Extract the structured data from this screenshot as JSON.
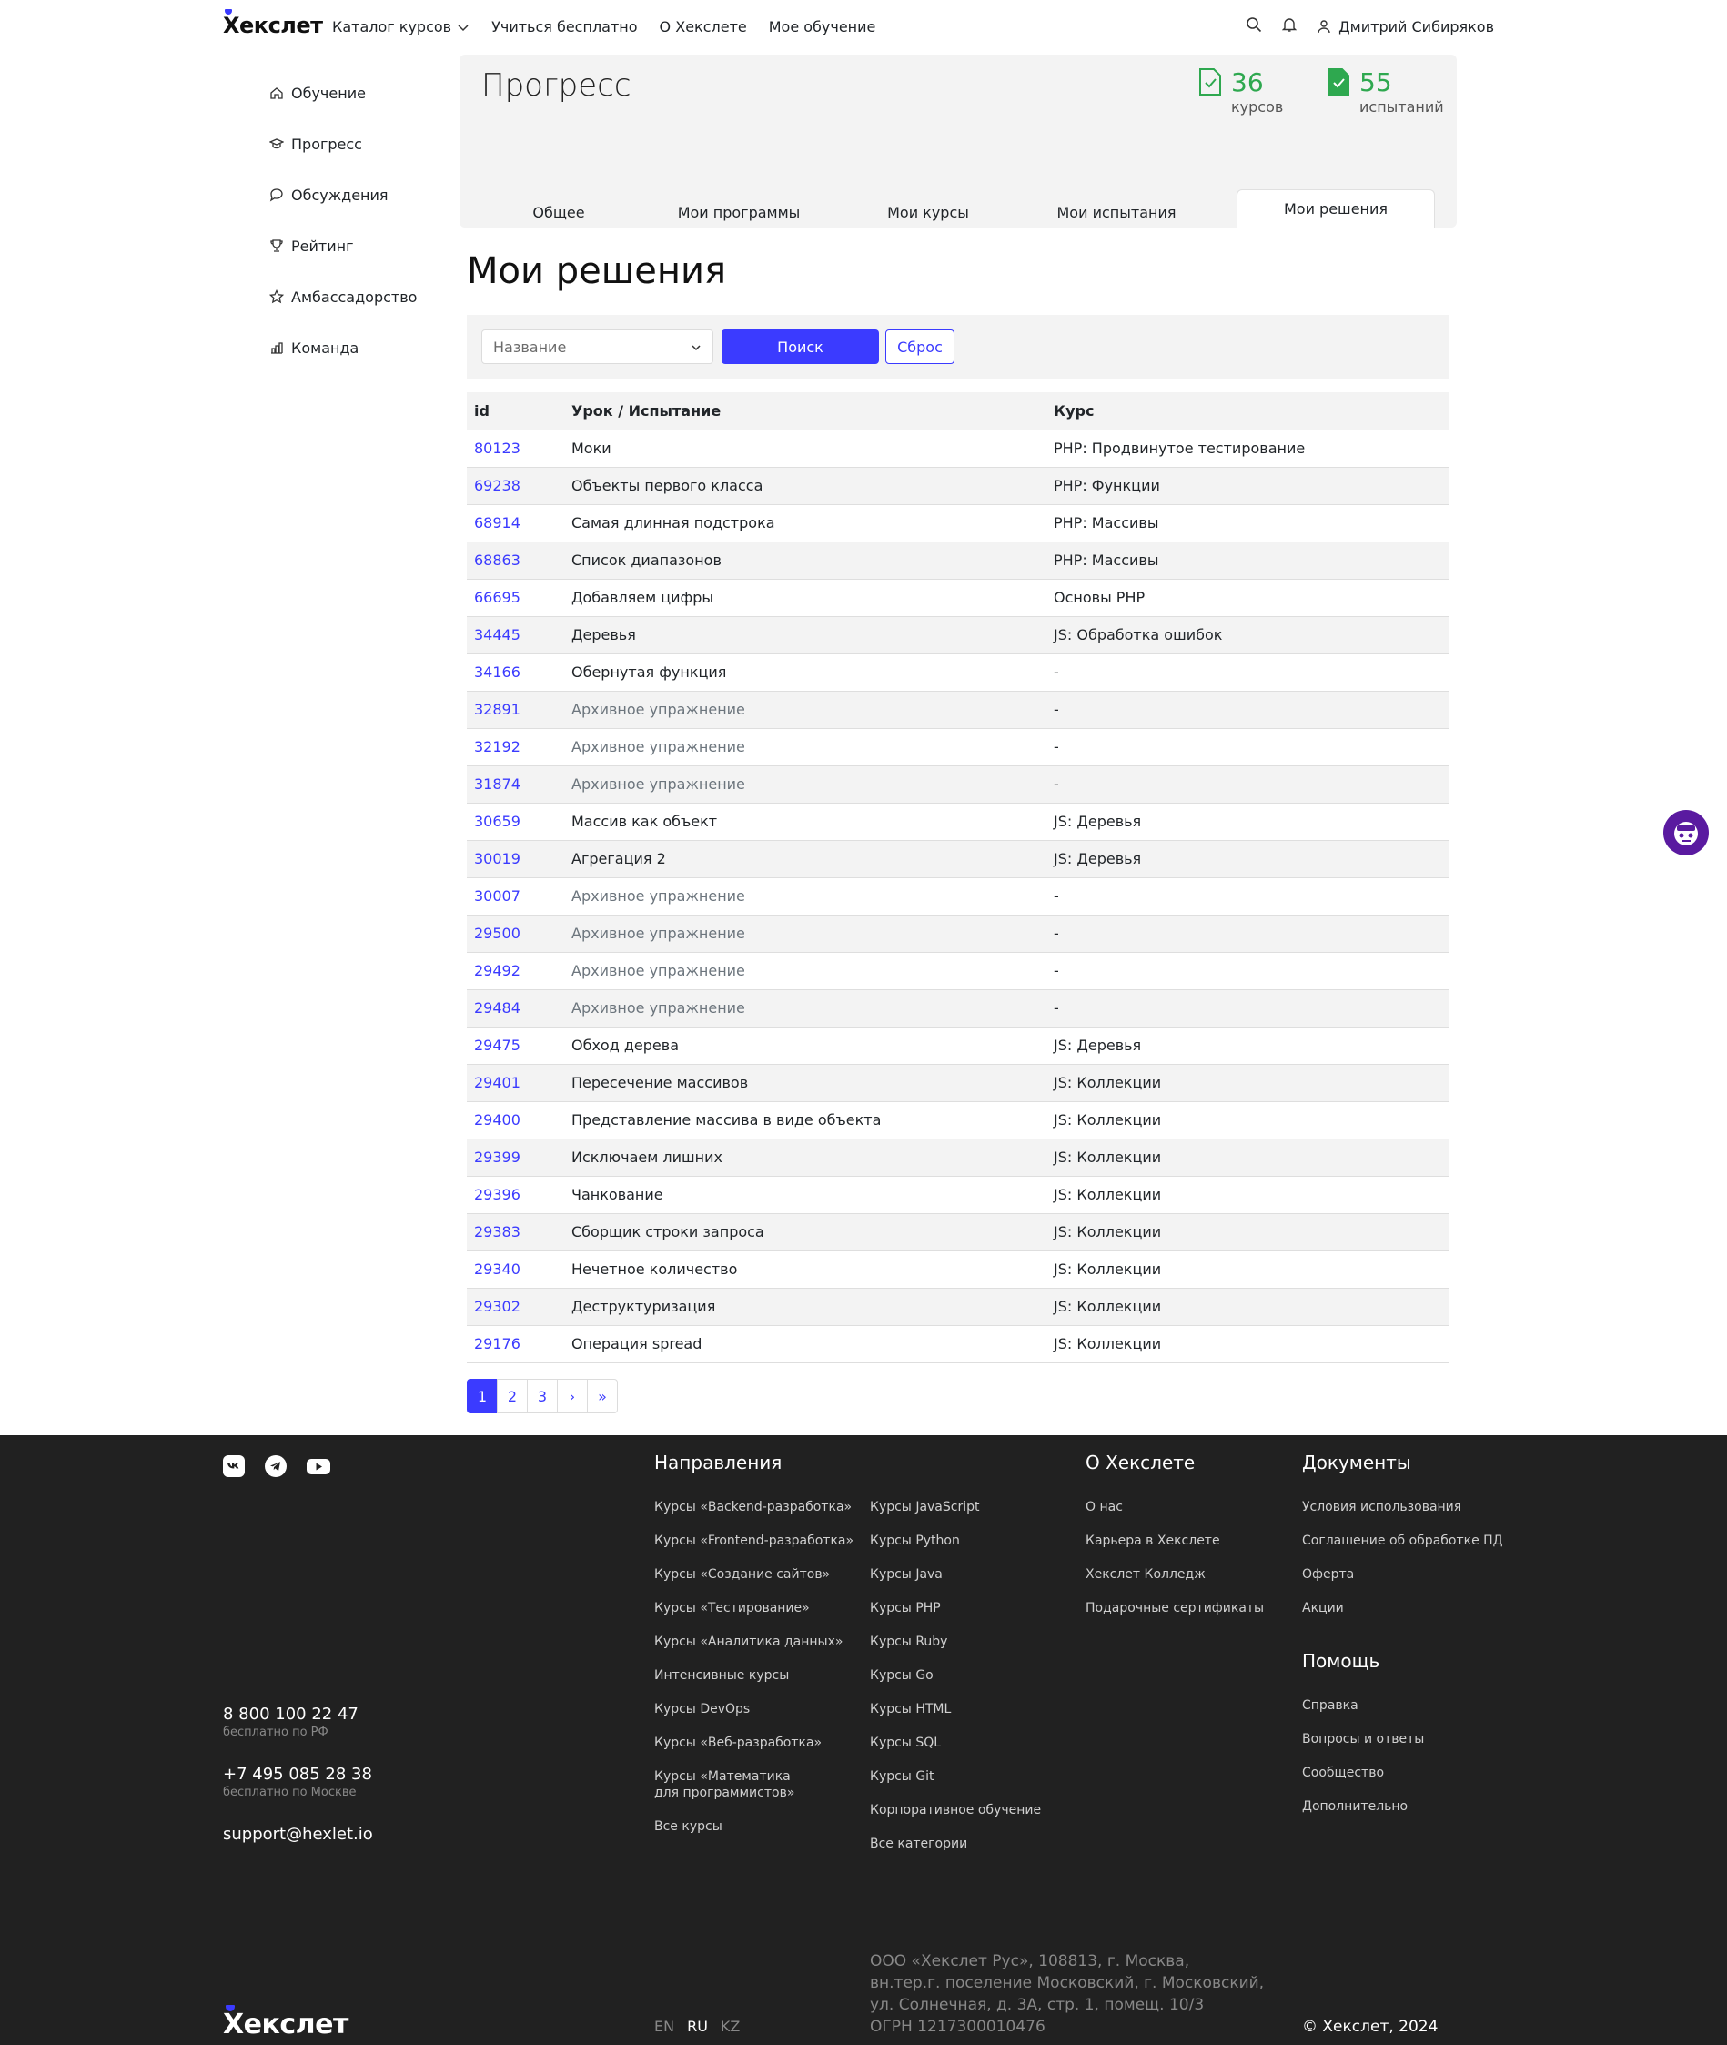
{
  "header": {
    "logo": "Хекслет",
    "nav": [
      "Каталог курсов",
      "Учиться бесплатно",
      "О Хекслете",
      "Мое обучение"
    ],
    "user_name": "Дмитрий Сибиряков"
  },
  "sidebar": {
    "items": [
      {
        "label": "Обучение",
        "icon": "home-icon"
      },
      {
        "label": "Прогресс",
        "icon": "graduation-cap-icon"
      },
      {
        "label": "Обсуждения",
        "icon": "chat-bubble-icon"
      },
      {
        "label": "Рейтинг",
        "icon": "trophy-icon"
      },
      {
        "label": "Амбассадорство",
        "icon": "star-icon"
      },
      {
        "label": "Команда",
        "icon": "team-chart-icon"
      }
    ]
  },
  "progress": {
    "title": "Прогресс",
    "courses_count": "36",
    "courses_label": "курсов",
    "challenges_count": "55",
    "challenges_label": "испытаний",
    "tabs": [
      "Общее",
      "Мои программы",
      "Мои курсы",
      "Мои испытания",
      "Мои решения"
    ],
    "active_tab": "Мои решения"
  },
  "main": {
    "title": "Мои решения",
    "filter": {
      "select_value": "Название",
      "search_label": "Поиск",
      "reset_label": "Сброс"
    },
    "table": {
      "columns": [
        "id",
        "Урок / Испытание",
        "Курс"
      ],
      "rows": [
        {
          "id": "80123",
          "lesson": "Моки",
          "course": "PHP: Продвинутое тестирование"
        },
        {
          "id": "69238",
          "lesson": "Объекты первого класса",
          "course": "PHP: Функции"
        },
        {
          "id": "68914",
          "lesson": "Самая длинная подстрока",
          "course": "PHP: Массивы"
        },
        {
          "id": "68863",
          "lesson": "Список диапазонов",
          "course": "PHP: Массивы"
        },
        {
          "id": "66695",
          "lesson": "Добавляем цифры",
          "course": "Основы PHP"
        },
        {
          "id": "34445",
          "lesson": "Деревья",
          "course": "JS: Обработка ошибок"
        },
        {
          "id": "34166",
          "lesson": "Обернутая функция",
          "course": "-"
        },
        {
          "id": "32891",
          "lesson": "Архивное упражнение",
          "course": "-",
          "muted": true
        },
        {
          "id": "32192",
          "lesson": "Архивное упражнение",
          "course": "-",
          "muted": true
        },
        {
          "id": "31874",
          "lesson": "Архивное упражнение",
          "course": "-",
          "muted": true
        },
        {
          "id": "30659",
          "lesson": "Массив как объект",
          "course": "JS: Деревья"
        },
        {
          "id": "30019",
          "lesson": "Агрегация 2",
          "course": "JS: Деревья"
        },
        {
          "id": "30007",
          "lesson": "Архивное упражнение",
          "course": "-",
          "muted": true
        },
        {
          "id": "29500",
          "lesson": "Архивное упражнение",
          "course": "-",
          "muted": true
        },
        {
          "id": "29492",
          "lesson": "Архивное упражнение",
          "course": "-",
          "muted": true
        },
        {
          "id": "29484",
          "lesson": "Архивное упражнение",
          "course": "-",
          "muted": true
        },
        {
          "id": "29475",
          "lesson": "Обход дерева",
          "course": "JS: Деревья"
        },
        {
          "id": "29401",
          "lesson": "Пересечение массивов",
          "course": "JS: Коллекции"
        },
        {
          "id": "29400",
          "lesson": "Представление массива в виде объекта",
          "course": "JS: Коллекции"
        },
        {
          "id": "29399",
          "lesson": "Исключаем лишних",
          "course": "JS: Коллекции"
        },
        {
          "id": "29396",
          "lesson": "Чанкование",
          "course": "JS: Коллекции"
        },
        {
          "id": "29383",
          "lesson": "Сборщик строки запроса",
          "course": "JS: Коллекции"
        },
        {
          "id": "29340",
          "lesson": "Нечетное количество",
          "course": "JS: Коллекции"
        },
        {
          "id": "29302",
          "lesson": "Деструктуризация",
          "course": "JS: Коллекции"
        },
        {
          "id": "29176",
          "lesson": "Операция spread",
          "course": "JS: Коллекции"
        }
      ]
    },
    "pagination": [
      "1",
      "2",
      "3",
      "›",
      "»"
    ],
    "current_page": "1"
  },
  "footer": {
    "directions_title": "Направления",
    "directions_col1": [
      "Курсы «Backend-разработка»",
      "Курсы «Frontend-разработка»",
      "Курсы «Создание сайтов»",
      "Курсы «Тестирование»",
      "Курсы «Аналитика данных»",
      "Интенсивные курсы",
      "Курсы DevOps",
      "Курсы «Веб-разработка»",
      "Курсы «Математика для программистов»",
      "Все курсы"
    ],
    "directions_col2": [
      "Курсы JavaScript",
      "Курсы Python",
      "Курсы Java",
      "Курсы PHP",
      "Курсы Ruby",
      "Курсы Go",
      "Курсы HTML",
      "Курсы SQL",
      "Курсы Git",
      "Корпоративное обучение",
      "Все категории"
    ],
    "about_title": "О Хекслете",
    "about_items": [
      "О нас",
      "Карьера в Хекслете",
      "Хекслет Колледж",
      "Подарочные сертификаты"
    ],
    "docs_title": "Документы",
    "docs_items": [
      "Условия использования",
      "Соглашение об обработке ПД",
      "Оферта",
      "Акции"
    ],
    "help_title": "Помощь",
    "help_items": [
      "Справка",
      "Вопросы и ответы",
      "Сообщество",
      "Дополнительно"
    ],
    "phone1": "8 800 100 22 47",
    "phone1_note": "бесплатно по РФ",
    "phone2": "+7 495 085 28 38",
    "phone2_note": "бесплатно по Москве",
    "email": "support@hexlet.io",
    "langs": [
      "EN",
      "RU",
      "KZ"
    ],
    "active_lang": "RU",
    "address_lines": [
      "ООО «Хекслет Рус», 108813, г. Москва,",
      "вн.тер.г. поселение Московский, г. Московский,",
      "ул. Солнечная, д. 3А, стр. 1, помещ. 10/3",
      "ОГРН 1217300010476"
    ],
    "copyright": "© Хекслет, 2024",
    "logo": "Хекслет"
  }
}
